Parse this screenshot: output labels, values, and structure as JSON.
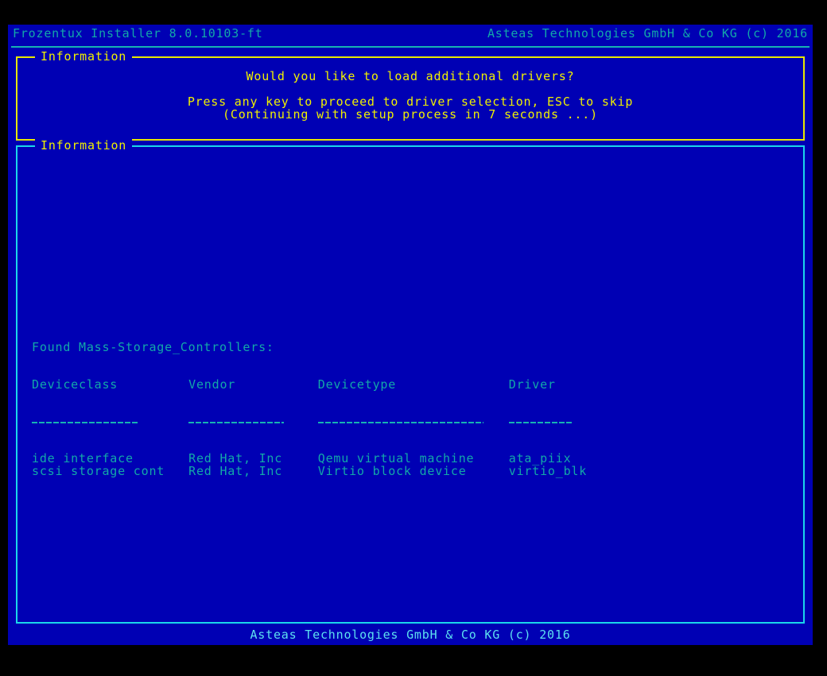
{
  "header": {
    "product": "Frozentux Installer 8.0.10103-ft",
    "vendor": "Asteas Technologies GmbH & Co KG (c) 2016"
  },
  "prompt_box": {
    "title": "Information",
    "border_color": "#e8e800",
    "text_color": "#f0f000",
    "question": "Would you like to load additional drivers?",
    "action": "Press any key to proceed to driver selection, ESC to skip",
    "countdown": "(Continuing with setup process in 7 seconds ...)"
  },
  "drivers_box": {
    "title": "Information",
    "border_color": "#1ad6ea",
    "text_color": "#12a8a8",
    "found_label": "Found Mass-Storage_Controllers:",
    "table": {
      "columns": [
        "Deviceclass",
        "Vendor",
        "Devicetype",
        "Driver"
      ],
      "rows": [
        [
          "ide interface",
          "Red Hat, Inc",
          "Qemu virtual machine",
          "ata_piix"
        ],
        [
          "scsi storage cont",
          "Red Hat, Inc",
          "Virtio block device",
          "virtio_blk"
        ]
      ]
    }
  },
  "footer": {
    "copyright": "Asteas Technologies GmbH & Co KG (c) 2016"
  }
}
